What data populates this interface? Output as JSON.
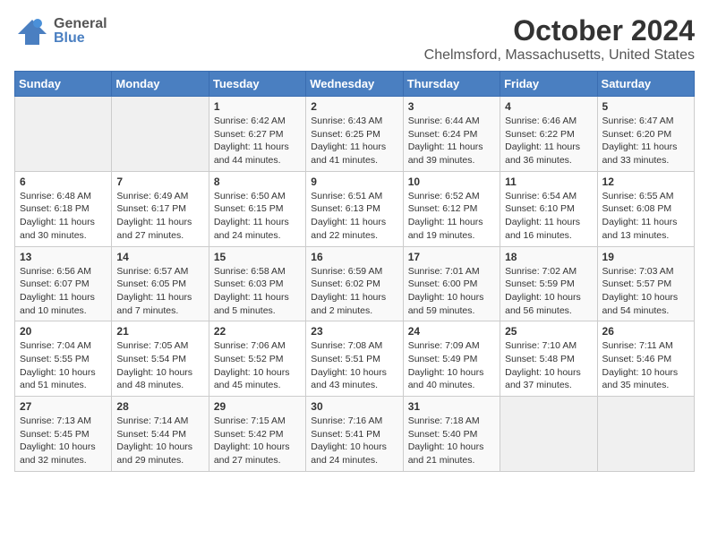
{
  "header": {
    "logo_general": "General",
    "logo_blue": "Blue",
    "month_title": "October 2024",
    "location": "Chelmsford, Massachusetts, United States"
  },
  "weekdays": [
    "Sunday",
    "Monday",
    "Tuesday",
    "Wednesday",
    "Thursday",
    "Friday",
    "Saturday"
  ],
  "weeks": [
    [
      {
        "day": "",
        "detail": ""
      },
      {
        "day": "",
        "detail": ""
      },
      {
        "day": "1",
        "detail": "Sunrise: 6:42 AM\nSunset: 6:27 PM\nDaylight: 11 hours\nand 44 minutes."
      },
      {
        "day": "2",
        "detail": "Sunrise: 6:43 AM\nSunset: 6:25 PM\nDaylight: 11 hours\nand 41 minutes."
      },
      {
        "day": "3",
        "detail": "Sunrise: 6:44 AM\nSunset: 6:24 PM\nDaylight: 11 hours\nand 39 minutes."
      },
      {
        "day": "4",
        "detail": "Sunrise: 6:46 AM\nSunset: 6:22 PM\nDaylight: 11 hours\nand 36 minutes."
      },
      {
        "day": "5",
        "detail": "Sunrise: 6:47 AM\nSunset: 6:20 PM\nDaylight: 11 hours\nand 33 minutes."
      }
    ],
    [
      {
        "day": "6",
        "detail": "Sunrise: 6:48 AM\nSunset: 6:18 PM\nDaylight: 11 hours\nand 30 minutes."
      },
      {
        "day": "7",
        "detail": "Sunrise: 6:49 AM\nSunset: 6:17 PM\nDaylight: 11 hours\nand 27 minutes."
      },
      {
        "day": "8",
        "detail": "Sunrise: 6:50 AM\nSunset: 6:15 PM\nDaylight: 11 hours\nand 24 minutes."
      },
      {
        "day": "9",
        "detail": "Sunrise: 6:51 AM\nSunset: 6:13 PM\nDaylight: 11 hours\nand 22 minutes."
      },
      {
        "day": "10",
        "detail": "Sunrise: 6:52 AM\nSunset: 6:12 PM\nDaylight: 11 hours\nand 19 minutes."
      },
      {
        "day": "11",
        "detail": "Sunrise: 6:54 AM\nSunset: 6:10 PM\nDaylight: 11 hours\nand 16 minutes."
      },
      {
        "day": "12",
        "detail": "Sunrise: 6:55 AM\nSunset: 6:08 PM\nDaylight: 11 hours\nand 13 minutes."
      }
    ],
    [
      {
        "day": "13",
        "detail": "Sunrise: 6:56 AM\nSunset: 6:07 PM\nDaylight: 11 hours\nand 10 minutes."
      },
      {
        "day": "14",
        "detail": "Sunrise: 6:57 AM\nSunset: 6:05 PM\nDaylight: 11 hours\nand 7 minutes."
      },
      {
        "day": "15",
        "detail": "Sunrise: 6:58 AM\nSunset: 6:03 PM\nDaylight: 11 hours\nand 5 minutes."
      },
      {
        "day": "16",
        "detail": "Sunrise: 6:59 AM\nSunset: 6:02 PM\nDaylight: 11 hours\nand 2 minutes."
      },
      {
        "day": "17",
        "detail": "Sunrise: 7:01 AM\nSunset: 6:00 PM\nDaylight: 10 hours\nand 59 minutes."
      },
      {
        "day": "18",
        "detail": "Sunrise: 7:02 AM\nSunset: 5:59 PM\nDaylight: 10 hours\nand 56 minutes."
      },
      {
        "day": "19",
        "detail": "Sunrise: 7:03 AM\nSunset: 5:57 PM\nDaylight: 10 hours\nand 54 minutes."
      }
    ],
    [
      {
        "day": "20",
        "detail": "Sunrise: 7:04 AM\nSunset: 5:55 PM\nDaylight: 10 hours\nand 51 minutes."
      },
      {
        "day": "21",
        "detail": "Sunrise: 7:05 AM\nSunset: 5:54 PM\nDaylight: 10 hours\nand 48 minutes."
      },
      {
        "day": "22",
        "detail": "Sunrise: 7:06 AM\nSunset: 5:52 PM\nDaylight: 10 hours\nand 45 minutes."
      },
      {
        "day": "23",
        "detail": "Sunrise: 7:08 AM\nSunset: 5:51 PM\nDaylight: 10 hours\nand 43 minutes."
      },
      {
        "day": "24",
        "detail": "Sunrise: 7:09 AM\nSunset: 5:49 PM\nDaylight: 10 hours\nand 40 minutes."
      },
      {
        "day": "25",
        "detail": "Sunrise: 7:10 AM\nSunset: 5:48 PM\nDaylight: 10 hours\nand 37 minutes."
      },
      {
        "day": "26",
        "detail": "Sunrise: 7:11 AM\nSunset: 5:46 PM\nDaylight: 10 hours\nand 35 minutes."
      }
    ],
    [
      {
        "day": "27",
        "detail": "Sunrise: 7:13 AM\nSunset: 5:45 PM\nDaylight: 10 hours\nand 32 minutes."
      },
      {
        "day": "28",
        "detail": "Sunrise: 7:14 AM\nSunset: 5:44 PM\nDaylight: 10 hours\nand 29 minutes."
      },
      {
        "day": "29",
        "detail": "Sunrise: 7:15 AM\nSunset: 5:42 PM\nDaylight: 10 hours\nand 27 minutes."
      },
      {
        "day": "30",
        "detail": "Sunrise: 7:16 AM\nSunset: 5:41 PM\nDaylight: 10 hours\nand 24 minutes."
      },
      {
        "day": "31",
        "detail": "Sunrise: 7:18 AM\nSunset: 5:40 PM\nDaylight: 10 hours\nand 21 minutes."
      },
      {
        "day": "",
        "detail": ""
      },
      {
        "day": "",
        "detail": ""
      }
    ]
  ]
}
